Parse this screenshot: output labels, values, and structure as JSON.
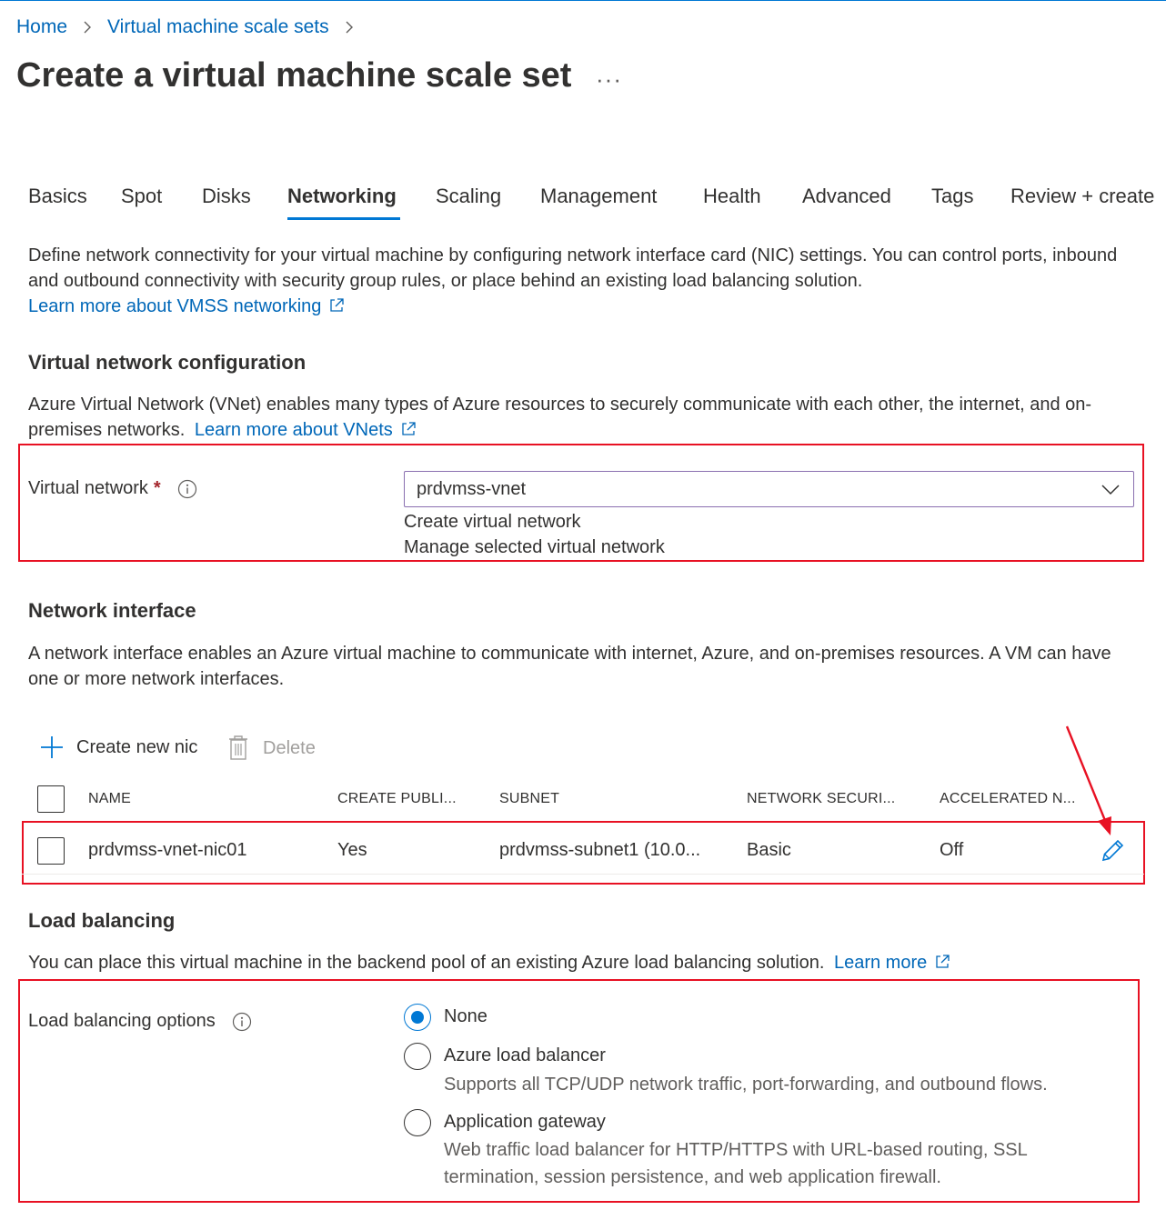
{
  "breadcrumb": {
    "home": "Home",
    "scale_sets": "Virtual machine scale sets"
  },
  "page": {
    "title": "Create a virtual machine scale set",
    "more": "···"
  },
  "tabs": [
    {
      "label": "Basics"
    },
    {
      "label": "Spot"
    },
    {
      "label": "Disks"
    },
    {
      "label": "Networking"
    },
    {
      "label": "Scaling"
    },
    {
      "label": "Management"
    },
    {
      "label": "Health"
    },
    {
      "label": "Advanced"
    },
    {
      "label": "Tags"
    },
    {
      "label": "Review + create"
    }
  ],
  "active_tab": "Networking",
  "intro": {
    "text": "Define network connectivity for your virtual machine by configuring network interface card (NIC) settings. You can control ports, inbound and outbound connectivity with security group rules, or place behind an existing load balancing solution.",
    "link": "Learn more about VMSS networking"
  },
  "vnet_config": {
    "heading": "Virtual network configuration",
    "text": "Azure Virtual Network (VNet) enables many types of Azure resources to securely communicate with each other, the internet, and on-premises networks.",
    "link": "Learn more about VNets",
    "field_label": "Virtual network",
    "required_mark": "*",
    "selected_value": "prdvmss-vnet",
    "create_link": "Create virtual network",
    "manage_link": "Manage selected virtual network"
  },
  "network_interface": {
    "heading": "Network interface",
    "text": "A network interface enables an Azure virtual machine to communicate with internet, Azure, and on-premises resources. A VM can have one or more network interfaces.",
    "create_nic": "Create new nic",
    "delete": "Delete",
    "columns": [
      "NAME",
      "CREATE PUBLI...",
      "SUBNET",
      "NETWORK SECURI...",
      "ACCELERATED N..."
    ],
    "rows": [
      {
        "name": "prdvmss-vnet-nic01",
        "create_public": "Yes",
        "subnet": "prdvmss-subnet1 (10.0...",
        "nsg": "Basic",
        "accelerated": "Off"
      }
    ]
  },
  "load_balancing": {
    "heading": "Load balancing",
    "text": "You can place this virtual machine in the backend pool of an existing Azure load balancing solution.",
    "link": "Learn more",
    "field_label": "Load balancing options",
    "options": [
      {
        "label": "None",
        "desc": "",
        "checked": true
      },
      {
        "label": "Azure load balancer",
        "desc": "Supports all TCP/UDP network traffic, port-forwarding, and outbound flows.",
        "checked": false
      },
      {
        "label": "Application gateway",
        "desc": "Web traffic load balancer for HTTP/HTTPS with URL-based routing, SSL termination, session persistence, and web application firewall.",
        "checked": false
      }
    ]
  },
  "colors": {
    "accent": "#0078d4",
    "link": "#0067b8",
    "annotation": "#e81123"
  },
  "icons": [
    "chevron-right-icon",
    "more-icon",
    "external-link-icon",
    "info-icon",
    "chevron-down-icon",
    "plus-icon",
    "trash-icon",
    "pencil-icon",
    "annotation-arrow"
  ]
}
